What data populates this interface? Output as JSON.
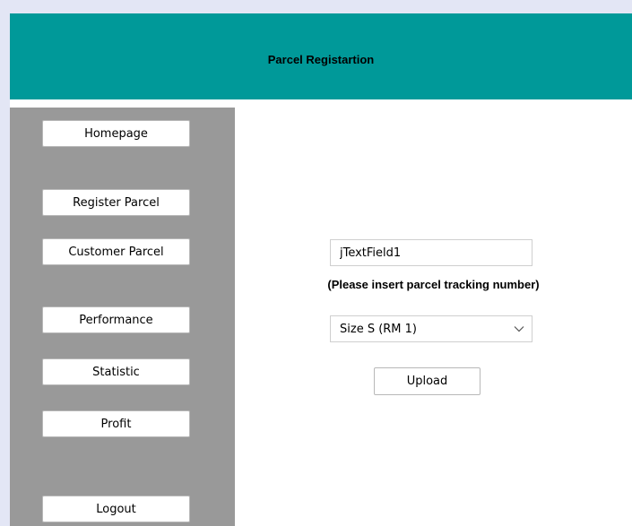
{
  "window": {
    "title": "Parcel Registartion"
  },
  "sidebar": {
    "items": [
      {
        "label": "Homepage"
      },
      {
        "label": "Register Parcel"
      },
      {
        "label": "Customer Parcel"
      },
      {
        "label": "Performance"
      },
      {
        "label": "Statistic"
      },
      {
        "label": "Profit"
      },
      {
        "label": "Logout"
      }
    ]
  },
  "form": {
    "tracking_input_value": "jTextField1",
    "hint": "(Please insert parcel tracking number)",
    "size_select_value": "Size S (RM 1)",
    "upload_label": "Upload"
  },
  "icons": {
    "dropdown": "chevron-down-icon"
  },
  "colors": {
    "header": "#009999",
    "sidebar": "#999999",
    "background": "#e3e6f5"
  }
}
